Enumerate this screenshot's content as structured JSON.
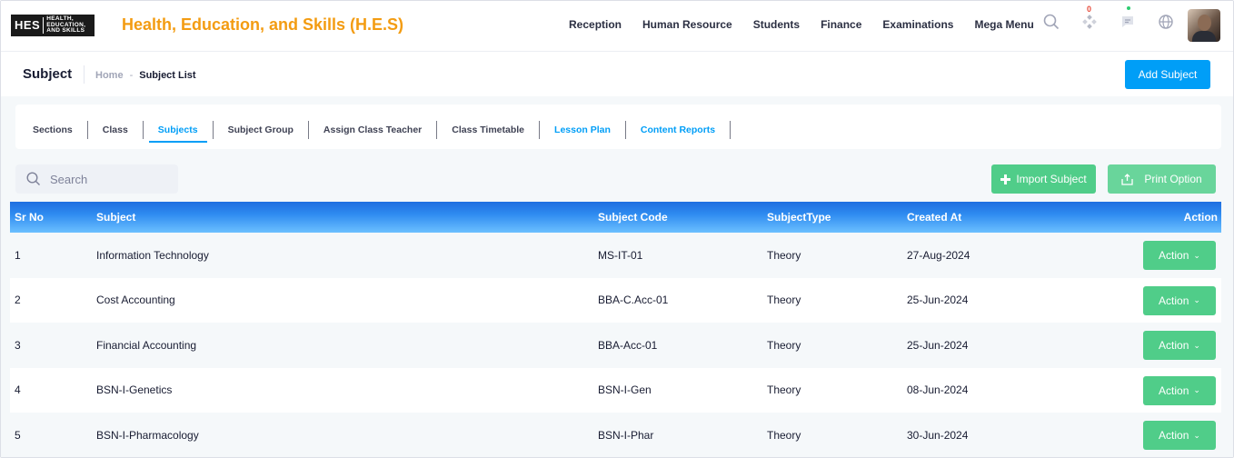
{
  "header": {
    "logo_mark": "HES",
    "logo_line1": "HEALTH,",
    "logo_line2": "EDUCATION,",
    "logo_line3": "AND SKILLS",
    "app_title": "Health, Education, and Skills (H.E.S)",
    "nav": [
      "Reception",
      "Human Resource",
      "Students",
      "Finance",
      "Examinations",
      "Mega Menu"
    ],
    "notification_count": "0",
    "icons": [
      "search-icon",
      "apps-icon",
      "chat-icon",
      "globe-icon"
    ]
  },
  "subheader": {
    "title": "Subject",
    "breadcrumb_home": "Home",
    "breadcrumb_sep": "-",
    "breadcrumb_current": "Subject List",
    "add_button": "Add Subject"
  },
  "tabs": [
    {
      "label": "Sections",
      "state": "normal"
    },
    {
      "label": "Class",
      "state": "normal"
    },
    {
      "label": "Subjects",
      "state": "active"
    },
    {
      "label": "Subject Group",
      "state": "normal"
    },
    {
      "label": "Assign Class Teacher",
      "state": "normal"
    },
    {
      "label": "Class Timetable",
      "state": "normal"
    },
    {
      "label": "Lesson Plan",
      "state": "link"
    },
    {
      "label": "Content Reports",
      "state": "link"
    }
  ],
  "toolbar": {
    "search_placeholder": "Search",
    "import_button": "Import Subject",
    "print_button": "Print Option"
  },
  "table": {
    "columns": {
      "sr": "Sr No",
      "subject": "Subject",
      "code": "Subject Code",
      "type": "SubjectType",
      "created": "Created At",
      "action": "Action"
    },
    "rows": [
      {
        "sr": "1",
        "subject": "Information Technology",
        "code": "MS-IT-01",
        "type": "Theory",
        "created": "27-Aug-2024",
        "action": "Action"
      },
      {
        "sr": "2",
        "subject": "Cost Accounting",
        "code": "BBA-C.Acc-01",
        "type": "Theory",
        "created": "25-Jun-2024",
        "action": "Action"
      },
      {
        "sr": "3",
        "subject": "Financial Accounting",
        "code": "BBA-Acc-01",
        "type": "Theory",
        "created": "25-Jun-2024",
        "action": "Action"
      },
      {
        "sr": "4",
        "subject": "BSN-I-Genetics",
        "code": "BSN-I-Gen",
        "type": "Theory",
        "created": "08-Jun-2024",
        "action": "Action"
      },
      {
        "sr": "5",
        "subject": "BSN-I-Pharmacology",
        "code": "BSN-I-Phar",
        "type": "Theory",
        "created": "30-Jun-2024",
        "action": "Action"
      }
    ]
  },
  "colors": {
    "brand_orange": "#f39c12",
    "primary_blue": "#009ef7",
    "success_green": "#50cd89"
  }
}
